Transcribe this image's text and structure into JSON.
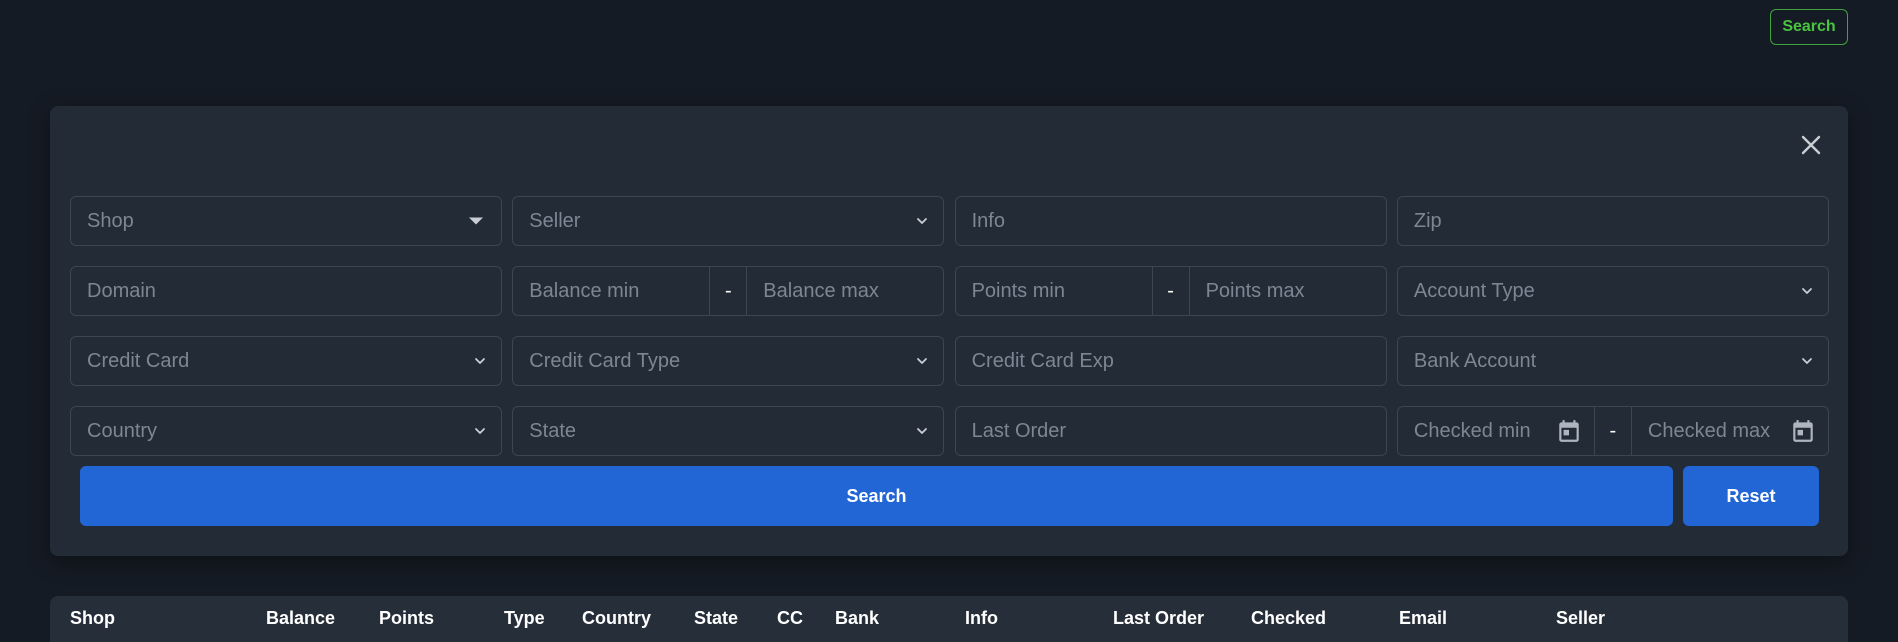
{
  "header": {
    "search_button": "Search"
  },
  "filters": {
    "shop": "Shop",
    "seller": "Seller",
    "info": "Info",
    "zip": "Zip",
    "domain": "Domain",
    "balance_min": "Balance min",
    "balance_max": "Balance max",
    "points_min": "Points min",
    "points_max": "Points max",
    "account_type": "Account Type",
    "credit_card": "Credit Card",
    "credit_card_type": "Credit Card Type",
    "credit_card_exp": "Credit Card Exp",
    "bank_account": "Bank Account",
    "country": "Country",
    "state": "State",
    "last_order": "Last Order",
    "checked_min": "Checked min",
    "checked_max": "Checked max",
    "range_separator": "-"
  },
  "actions": {
    "search": "Search",
    "reset": "Reset"
  },
  "table": {
    "columns": [
      "Shop",
      "Balance",
      "Points",
      "Type",
      "Country",
      "State",
      "CC",
      "Bank",
      "Info",
      "Last Order",
      "Checked",
      "Email",
      "Seller"
    ]
  },
  "icons": {
    "close": "close-icon",
    "chevron": "chevron-down-icon",
    "caret": "caret-down-icon",
    "calendar": "calendar-icon"
  },
  "colors": {
    "background": "#151b24",
    "panel": "#222b36",
    "primary": "#2266d6",
    "accent_green": "#48c43f",
    "placeholder": "#7d8793"
  }
}
